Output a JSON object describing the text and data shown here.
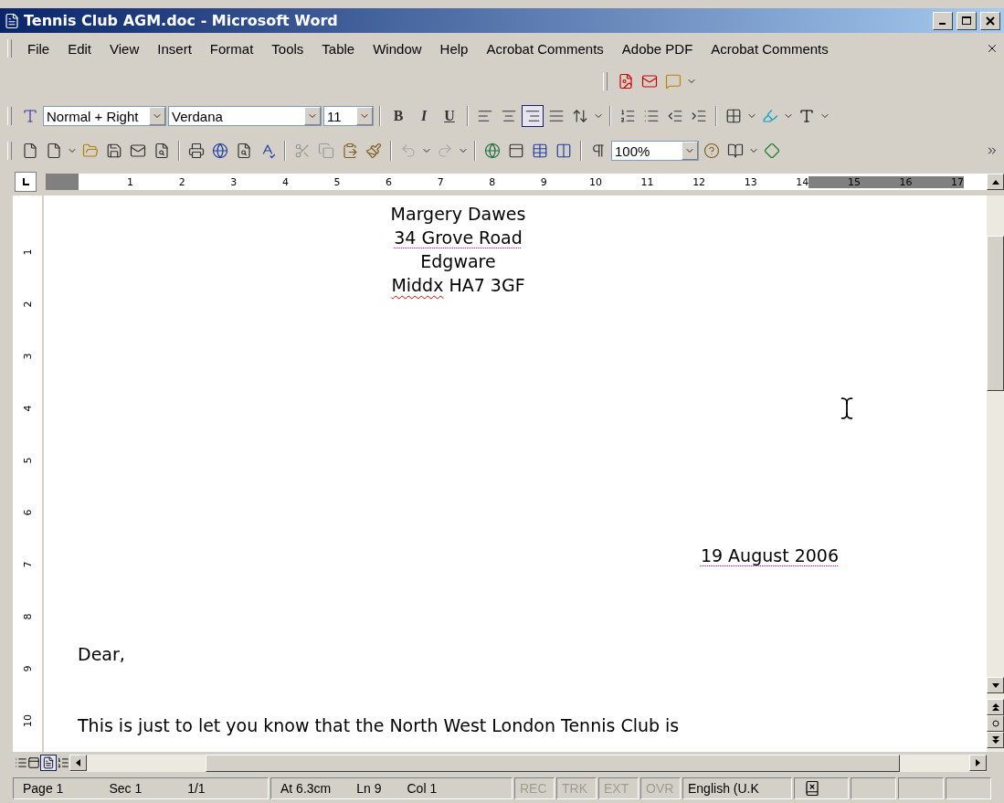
{
  "window": {
    "title": "Tennis Club AGM.doc - Microsoft Word"
  },
  "menu": [
    {
      "label": "File"
    },
    {
      "label": "Edit"
    },
    {
      "label": "View"
    },
    {
      "label": "Insert"
    },
    {
      "label": "Format"
    },
    {
      "label": "Tools"
    },
    {
      "label": "Table"
    },
    {
      "label": "Window"
    },
    {
      "label": "Help"
    },
    {
      "label": "Acrobat Comments"
    },
    {
      "label": "Adobe PDF"
    },
    {
      "label": "Acrobat Comments"
    }
  ],
  "formatting": {
    "style": "Normal + Right",
    "font": "Verdana",
    "size": "11",
    "text_buttons": [
      {
        "label": "B",
        "kind": "bold"
      },
      {
        "label": "I",
        "kind": "italic"
      },
      {
        "label": "U",
        "kind": "underline"
      }
    ],
    "alignment": [
      {
        "kind": "left",
        "selected": false
      },
      {
        "kind": "center",
        "selected": false
      },
      {
        "kind": "right",
        "selected": true
      },
      {
        "kind": "justify",
        "selected": false
      }
    ]
  },
  "standard": {
    "zoom": "100%"
  },
  "ruler": {
    "numbers": [
      "1",
      "2",
      "3",
      "4",
      "5",
      "6",
      "7",
      "8",
      "9",
      "10",
      "11",
      "12",
      "13",
      "14",
      "15",
      "16",
      "17"
    ],
    "vertical_numbers": [
      "1",
      "2",
      "3",
      "4",
      "5",
      "6",
      "7",
      "8",
      "9",
      "10"
    ]
  },
  "document": {
    "lines": [
      {
        "kind": "address",
        "parts": [
          {
            "text": "Margery Dawes",
            "spelling_error": false,
            "grammar_error": false
          }
        ]
      },
      {
        "kind": "address",
        "parts": [
          {
            "text": "34 Grove Road",
            "spelling_error": false,
            "grammar_error": true
          }
        ]
      },
      {
        "kind": "address",
        "parts": [
          {
            "text": "Edgware",
            "spelling_error": false,
            "grammar_error": false
          }
        ]
      },
      {
        "kind": "address",
        "parts": [
          {
            "text": "Middx",
            "spelling_error": true,
            "grammar_error": false
          },
          {
            "text": " HA7 3GF",
            "spelling_error": false,
            "grammar_error": false
          }
        ]
      },
      {
        "kind": "date",
        "parts": [
          {
            "text": "19 August 2006",
            "spelling_error": false,
            "grammar_error": true
          }
        ]
      },
      {
        "kind": "salutation",
        "parts": [
          {
            "text": "Dear,",
            "spelling_error": false,
            "grammar_error": false
          }
        ]
      },
      {
        "kind": "body",
        "parts": [
          {
            "text": "This is just to let you know that the North West London Tennis Club is",
            "spelling_error": false,
            "grammar_error": false
          }
        ]
      }
    ]
  },
  "status_bar": [
    {
      "items": [
        {
          "text": "Page 1",
          "disabled": false
        },
        {
          "text": "Sec 1",
          "disabled": false
        },
        {
          "text": "1/1",
          "disabled": false
        }
      ]
    },
    {
      "items": [
        {
          "text": "At 6.3cm",
          "disabled": false
        },
        {
          "text": "Ln 9",
          "disabled": false
        },
        {
          "text": "Col 1",
          "disabled": false
        }
      ]
    },
    {
      "items": [
        {
          "text": "REC",
          "disabled": true
        }
      ]
    },
    {
      "items": [
        {
          "text": "TRK",
          "disabled": true
        }
      ]
    },
    {
      "items": [
        {
          "text": "EXT",
          "disabled": true
        }
      ]
    },
    {
      "items": [
        {
          "text": "OVR",
          "disabled": true
        }
      ]
    },
    {
      "items": [
        {
          "text": "English (U.K",
          "disabled": false
        }
      ]
    }
  ]
}
